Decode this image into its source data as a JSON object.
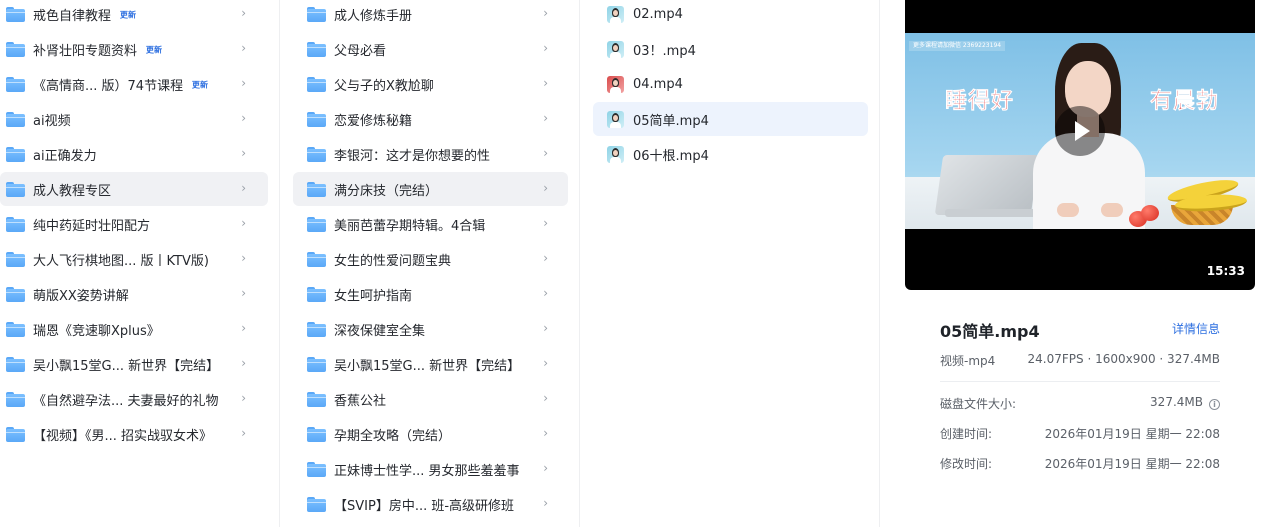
{
  "column1": {
    "items": [
      {
        "label": "戒色自律教程",
        "badge": "更新"
      },
      {
        "label": "补肾壮阳专题资料",
        "badge": "更新"
      },
      {
        "label": "《高情商...  版）74节课程",
        "badge": "更新"
      },
      {
        "label": "ai视频",
        "badge": ""
      },
      {
        "label": "ai正确发力",
        "badge": ""
      },
      {
        "label": "成人教程专区",
        "badge": ""
      },
      {
        "label": "纯中药延时壮阳配方",
        "badge": ""
      },
      {
        "label": "大人飞行棋地图...  版丨KTV版)",
        "badge": ""
      },
      {
        "label": "萌版XX姿势讲解",
        "badge": ""
      },
      {
        "label": "瑞恩《竞速聊Xplus》",
        "badge": ""
      },
      {
        "label": "吴小飘15堂G...  新世界【完结】",
        "badge": ""
      },
      {
        "label": "《自然避孕法...  夫妻最好的礼物",
        "badge": ""
      },
      {
        "label": "【视频】《男...  招实战驭女术》",
        "badge": ""
      }
    ]
  },
  "column2": {
    "items": [
      {
        "label": "成人修炼手册"
      },
      {
        "label": "父母必看"
      },
      {
        "label": "父与子的X教尬聊"
      },
      {
        "label": "恋爱修炼秘籍"
      },
      {
        "label": "李银河：这才是你想要的性"
      },
      {
        "label": "满分床技（完结）"
      },
      {
        "label": "美丽芭蕾孕期特辑。4合辑"
      },
      {
        "label": "女生的性爱问题宝典"
      },
      {
        "label": "女生呵护指南"
      },
      {
        "label": "深夜保健室全集"
      },
      {
        "label": "吴小飘15堂G...  新世界【完结】"
      },
      {
        "label": "香蕉公社"
      },
      {
        "label": "孕期全攻略（完结）"
      },
      {
        "label": "正妹博士性学...  男女那些羞羞事"
      },
      {
        "label": "【SVIP】房中...  班-高级研修班"
      }
    ]
  },
  "column3": {
    "items": [
      {
        "label": "02.mp4"
      },
      {
        "label": "03！.mp4"
      },
      {
        "label": "04.mp4"
      },
      {
        "label": "05简单.mp4"
      },
      {
        "label": "06十根.mp4"
      }
    ]
  },
  "icons": {
    "chevron": "›",
    "folder": "folder-icon",
    "video": "video-file-icon",
    "play": "play-icon",
    "info": "info-icon"
  },
  "preview": {
    "caption": "更多课程请加微信  2369223194",
    "overlay_left": "睡得好",
    "overlay_right": "有晨勃",
    "duration": "15:33"
  },
  "details": {
    "title": "05简单.mp4",
    "link": "详情信息",
    "type_label": "视频-mp4",
    "type_value": "24.07FPS · 1600x900 · 327.4MB",
    "size_label": "磁盘文件大小:",
    "size_value": "327.4MB",
    "created_label": "创建时间:",
    "created_value": "2026年01月19日 星期一 22:08",
    "modified_label": "修改时间:",
    "modified_value": "2026年01月19日 星期一 22:08",
    "info_glyph": "i"
  },
  "colors": {
    "accent": "#2d6fe0",
    "selected_gray": "#f0f1f4",
    "selected_blue": "#edf3fd",
    "folder": "#5aa8f7"
  }
}
